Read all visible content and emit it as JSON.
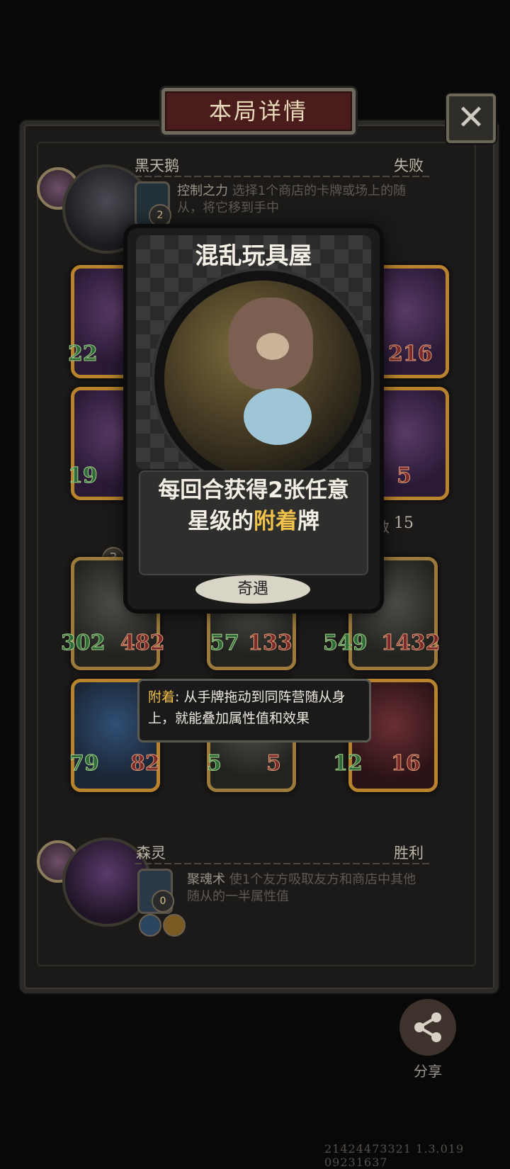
{
  "header": {
    "title": "本局详情",
    "close_icon": "close-icon"
  },
  "player1": {
    "name": "黑天鹅",
    "result": "失败",
    "skill_name": "控制之力",
    "skill_desc_line1": "选择1个商店的卡牌或场上的随",
    "skill_desc_line2": "从，将它移到手中",
    "skill_level": "2",
    "minions_row1": [
      {
        "atk": "22"
      },
      {
        "hp": "216"
      }
    ],
    "minions_row2": [
      {
        "atk": "19"
      },
      {
        "hp": "5"
      }
    ]
  },
  "round_info": {
    "label": "合数",
    "value": "15"
  },
  "player2": {
    "tier_badge": "3",
    "minions_row1": [
      {
        "atk": "302",
        "hp": "482"
      },
      {
        "atk": "57",
        "hp": "133"
      },
      {
        "atk": "549",
        "hp": "1432"
      }
    ],
    "minions_row2": [
      {
        "atk": "79",
        "hp": "82"
      },
      {
        "atk": "5",
        "hp": "5"
      },
      {
        "atk": "12",
        "hp": "16"
      }
    ],
    "name": "森灵",
    "result": "胜利",
    "skill_name": "聚魂术",
    "skill_desc_line1": "使1个友方吸取友方和商店中其他",
    "skill_desc_line2": "随从的一半属性值",
    "skill_level": "0"
  },
  "card": {
    "title": "混乱玩具屋",
    "desc_line1": "每回合获得2张任意",
    "desc_line2_pre": "星级的",
    "desc_line2_hl": "附着",
    "desc_line2_post": "牌",
    "type": "奇遇",
    "highlight_color": "#f1c24c"
  },
  "tooltip": {
    "keyword": "附着",
    "text1": ": 从手牌拖动到同阵营随从身",
    "text2": "上，就能叠加属性值和效果"
  },
  "share": {
    "label": "分享",
    "icon": "share-icon"
  },
  "build_id": "21424473321 1.3.019 09231637"
}
